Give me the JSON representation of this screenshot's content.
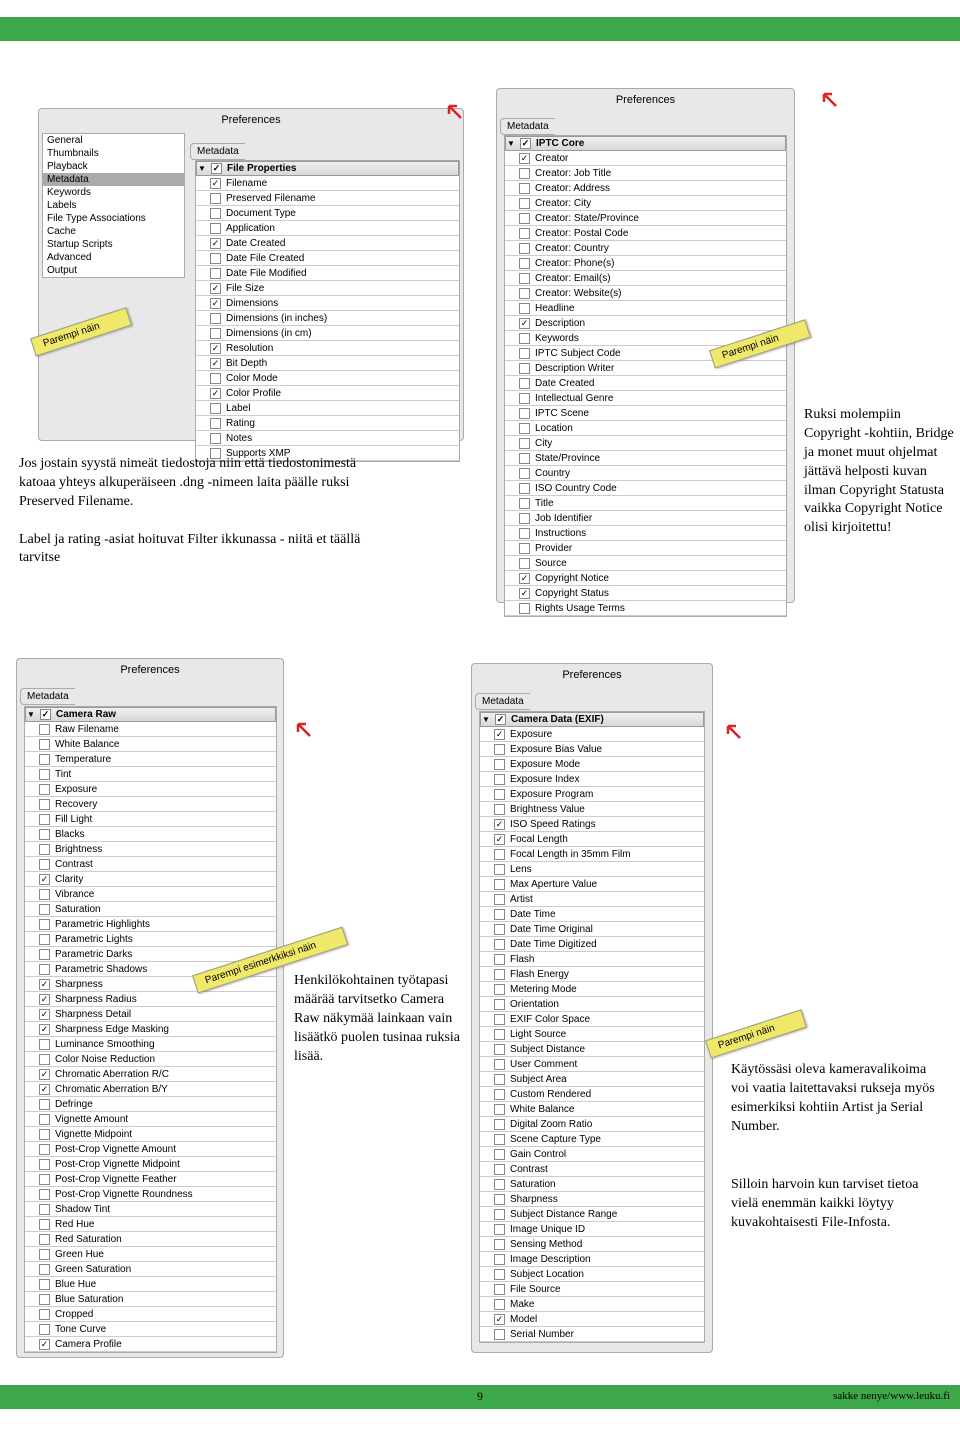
{
  "green_bar": {},
  "panel1": {
    "title": "Preferences",
    "tab": "Metadata",
    "sidebar": [
      "General",
      "Thumbnails",
      "Playback",
      "Metadata",
      "Keywords",
      "Labels",
      "File Type Associations",
      "Cache",
      "Startup Scripts",
      "Advanced",
      "Output"
    ],
    "sidebar_selected": 3,
    "group": "File Properties",
    "items": [
      {
        "label": "Filename",
        "checked": true
      },
      {
        "label": "Preserved Filename",
        "checked": false
      },
      {
        "label": "Document Type",
        "checked": false
      },
      {
        "label": "Application",
        "checked": false
      },
      {
        "label": "Date Created",
        "checked": true
      },
      {
        "label": "Date File Created",
        "checked": false
      },
      {
        "label": "Date File Modified",
        "checked": false
      },
      {
        "label": "File Size",
        "checked": true
      },
      {
        "label": "Dimensions",
        "checked": true
      },
      {
        "label": "Dimensions (in inches)",
        "checked": false
      },
      {
        "label": "Dimensions (in cm)",
        "checked": false
      },
      {
        "label": "Resolution",
        "checked": true
      },
      {
        "label": "Bit Depth",
        "checked": true
      },
      {
        "label": "Color Mode",
        "checked": false
      },
      {
        "label": "Color Profile",
        "checked": true
      },
      {
        "label": "Label",
        "checked": false
      },
      {
        "label": "Rating",
        "checked": false
      },
      {
        "label": "Notes",
        "checked": false
      },
      {
        "label": "Supports XMP",
        "checked": false
      }
    ]
  },
  "panel2": {
    "title": "Preferences",
    "tab": "Metadata",
    "group": "IPTC Core",
    "items": [
      {
        "label": "Creator",
        "checked": true
      },
      {
        "label": "Creator: Job Title",
        "checked": false
      },
      {
        "label": "Creator: Address",
        "checked": false
      },
      {
        "label": "Creator: City",
        "checked": false
      },
      {
        "label": "Creator: State/Province",
        "checked": false
      },
      {
        "label": "Creator: Postal Code",
        "checked": false
      },
      {
        "label": "Creator: Country",
        "checked": false
      },
      {
        "label": "Creator: Phone(s)",
        "checked": false
      },
      {
        "label": "Creator: Email(s)",
        "checked": false
      },
      {
        "label": "Creator: Website(s)",
        "checked": false
      },
      {
        "label": "Headline",
        "checked": false
      },
      {
        "label": "Description",
        "checked": true
      },
      {
        "label": "Keywords",
        "checked": false
      },
      {
        "label": "IPTC Subject Code",
        "checked": false
      },
      {
        "label": "Description Writer",
        "checked": false
      },
      {
        "label": "Date Created",
        "checked": false
      },
      {
        "label": "Intellectual Genre",
        "checked": false
      },
      {
        "label": "IPTC Scene",
        "checked": false
      },
      {
        "label": "Location",
        "checked": false
      },
      {
        "label": "City",
        "checked": false
      },
      {
        "label": "State/Province",
        "checked": false
      },
      {
        "label": "Country",
        "checked": false
      },
      {
        "label": "ISO Country Code",
        "checked": false
      },
      {
        "label": "Title",
        "checked": false
      },
      {
        "label": "Job Identifier",
        "checked": false
      },
      {
        "label": "Instructions",
        "checked": false
      },
      {
        "label": "Provider",
        "checked": false
      },
      {
        "label": "Source",
        "checked": false
      },
      {
        "label": "Copyright Notice",
        "checked": true
      },
      {
        "label": "Copyright Status",
        "checked": true
      },
      {
        "label": "Rights Usage Terms",
        "checked": false
      }
    ]
  },
  "panel3": {
    "title": "Preferences",
    "tab": "Metadata",
    "group": "Camera Raw",
    "items": [
      {
        "label": "Raw Filename",
        "checked": false
      },
      {
        "label": "White Balance",
        "checked": false
      },
      {
        "label": "Temperature",
        "checked": false
      },
      {
        "label": "Tint",
        "checked": false
      },
      {
        "label": "Exposure",
        "checked": false
      },
      {
        "label": "Recovery",
        "checked": false
      },
      {
        "label": "Fill Light",
        "checked": false
      },
      {
        "label": "Blacks",
        "checked": false
      },
      {
        "label": "Brightness",
        "checked": false
      },
      {
        "label": "Contrast",
        "checked": false
      },
      {
        "label": "Clarity",
        "checked": true
      },
      {
        "label": "Vibrance",
        "checked": false
      },
      {
        "label": "Saturation",
        "checked": false
      },
      {
        "label": "Parametric Highlights",
        "checked": false
      },
      {
        "label": "Parametric Lights",
        "checked": false
      },
      {
        "label": "Parametric Darks",
        "checked": false
      },
      {
        "label": "Parametric Shadows",
        "checked": false
      },
      {
        "label": "Sharpness",
        "checked": true
      },
      {
        "label": "Sharpness Radius",
        "checked": true
      },
      {
        "label": "Sharpness Detail",
        "checked": true
      },
      {
        "label": "Sharpness Edge Masking",
        "checked": true
      },
      {
        "label": "Luminance Smoothing",
        "checked": false
      },
      {
        "label": "Color Noise Reduction",
        "checked": false
      },
      {
        "label": "Chromatic Aberration R/C",
        "checked": true
      },
      {
        "label": "Chromatic Aberration B/Y",
        "checked": true
      },
      {
        "label": "Defringe",
        "checked": false
      },
      {
        "label": "Vignette Amount",
        "checked": false
      },
      {
        "label": "Vignette Midpoint",
        "checked": false
      },
      {
        "label": "Post-Crop Vignette Amount",
        "checked": false
      },
      {
        "label": "Post-Crop Vignette Midpoint",
        "checked": false
      },
      {
        "label": "Post-Crop Vignette Feather",
        "checked": false
      },
      {
        "label": "Post-Crop Vignette Roundness",
        "checked": false
      },
      {
        "label": "Shadow Tint",
        "checked": false
      },
      {
        "label": "Red Hue",
        "checked": false
      },
      {
        "label": "Red Saturation",
        "checked": false
      },
      {
        "label": "Green Hue",
        "checked": false
      },
      {
        "label": "Green Saturation",
        "checked": false
      },
      {
        "label": "Blue Hue",
        "checked": false
      },
      {
        "label": "Blue Saturation",
        "checked": false
      },
      {
        "label": "Cropped",
        "checked": false
      },
      {
        "label": "Tone Curve",
        "checked": false
      },
      {
        "label": "Camera Profile",
        "checked": true
      }
    ]
  },
  "panel4": {
    "title": "Preferences",
    "tab": "Metadata",
    "group": "Camera Data (EXIF)",
    "items": [
      {
        "label": "Exposure",
        "checked": true
      },
      {
        "label": "Exposure Bias Value",
        "checked": false
      },
      {
        "label": "Exposure Mode",
        "checked": false
      },
      {
        "label": "Exposure Index",
        "checked": false
      },
      {
        "label": "Exposure Program",
        "checked": false
      },
      {
        "label": "Brightness Value",
        "checked": false
      },
      {
        "label": "ISO Speed Ratings",
        "checked": true
      },
      {
        "label": "Focal Length",
        "checked": true
      },
      {
        "label": "Focal Length in 35mm Film",
        "checked": false
      },
      {
        "label": "Lens",
        "checked": false
      },
      {
        "label": "Max Aperture Value",
        "checked": false
      },
      {
        "label": "Artist",
        "checked": false
      },
      {
        "label": "Date Time",
        "checked": false
      },
      {
        "label": "Date Time Original",
        "checked": false
      },
      {
        "label": "Date Time Digitized",
        "checked": false
      },
      {
        "label": "Flash",
        "checked": false
      },
      {
        "label": "Flash Energy",
        "checked": false
      },
      {
        "label": "Metering Mode",
        "checked": false
      },
      {
        "label": "Orientation",
        "checked": false
      },
      {
        "label": "EXIF Color Space",
        "checked": false
      },
      {
        "label": "Light Source",
        "checked": false
      },
      {
        "label": "Subject Distance",
        "checked": false
      },
      {
        "label": "User Comment",
        "checked": false
      },
      {
        "label": "Subject Area",
        "checked": false
      },
      {
        "label": "Custom Rendered",
        "checked": false
      },
      {
        "label": "White Balance",
        "checked": false
      },
      {
        "label": "Digital Zoom Ratio",
        "checked": false
      },
      {
        "label": "Scene Capture Type",
        "checked": false
      },
      {
        "label": "Gain Control",
        "checked": false
      },
      {
        "label": "Contrast",
        "checked": false
      },
      {
        "label": "Saturation",
        "checked": false
      },
      {
        "label": "Sharpness",
        "checked": false
      },
      {
        "label": "Subject Distance Range",
        "checked": false
      },
      {
        "label": "Image Unique ID",
        "checked": false
      },
      {
        "label": "Sensing Method",
        "checked": false
      },
      {
        "label": "Image Description",
        "checked": false
      },
      {
        "label": "Subject Location",
        "checked": false
      },
      {
        "label": "File Source",
        "checked": false
      },
      {
        "label": "Make",
        "checked": false
      },
      {
        "label": "Model",
        "checked": true
      },
      {
        "label": "Serial Number",
        "checked": false
      }
    ]
  },
  "annot1": "Jos jostain syystä nimeät tiedostoja niin että tiedostonimestä katoaa yhteys alkuperäiseen .dng -nimeen laita päälle ruksi Preserved Filename.\n\nLabel ja rating -asiat hoituvat Filter ikkunassa - niitä et täällä tarvitse",
  "annot2": "Ruksi molempiin Copyright -kohtiin, Bridge ja monet muut ohjelmat jättävä helposti kuvan ilman Copyright Statusta vaikka Copyright Notice olisi kirjoitettu!",
  "annot3": "Henkilökohtainen työtapasi määrää tarvitsetko Camera Raw näkymää lainkaan vain lisäätkö puolen tusinaa ruksia lisää.",
  "annot4a": "Käytössäsi oleva kameravalikoima voi vaatia laitettavaksi rukseja myös esimerkiksi kohtiin Artist ja Serial Number.",
  "annot4b": "Silloin harvoin kun tarviset tietoa vielä enemmän kaikki löytyy kuvakohtaisesti File-Infosta.",
  "tags": {
    "t1": "Parempi näin",
    "t2": "Parempi näin",
    "t3": "Parempi esimerkkiksi näin",
    "t4": "Parempi näin"
  },
  "footer": {
    "page": "9",
    "credit": "sakke nenye/www.leuku.fi"
  }
}
